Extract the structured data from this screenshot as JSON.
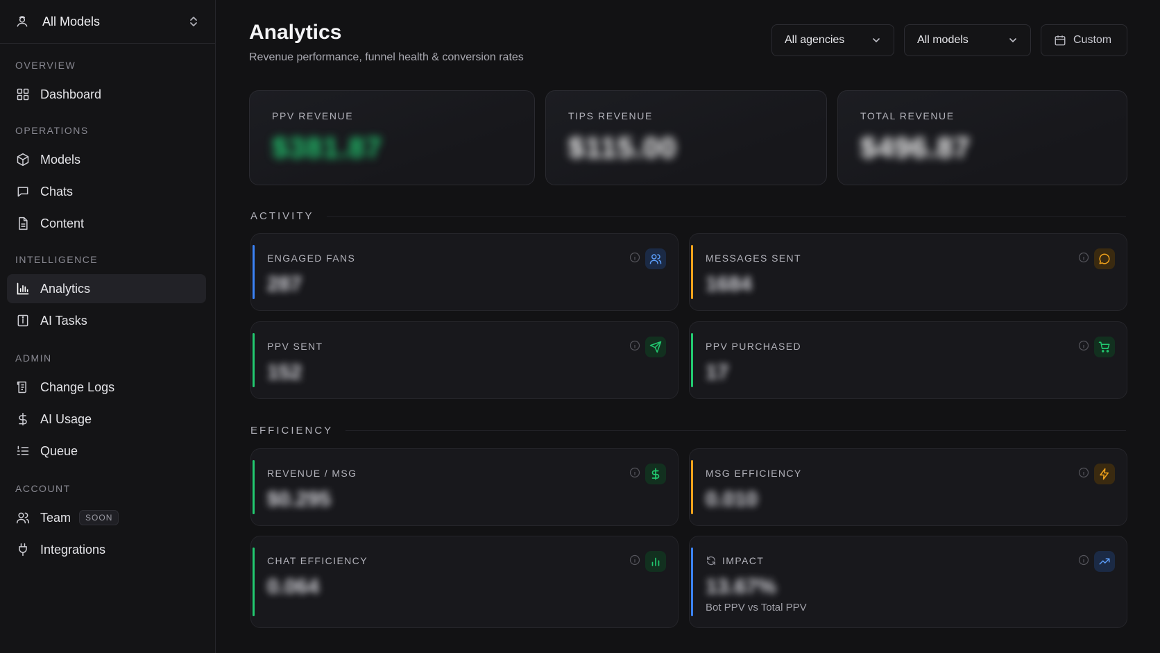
{
  "sidebar": {
    "model_switcher": {
      "label": "All Models"
    },
    "sections": {
      "overview": "OVERVIEW",
      "operations": "OPERATIONS",
      "intelligence": "INTELLIGENCE",
      "admin": "ADMIN",
      "account": "ACCOUNT"
    },
    "items": {
      "dashboard": "Dashboard",
      "models": "Models",
      "chats": "Chats",
      "content": "Content",
      "analytics": "Analytics",
      "ai_tasks": "AI Tasks",
      "change_logs": "Change Logs",
      "ai_usage": "AI Usage",
      "queue": "Queue",
      "team": "Team",
      "team_badge": "SOON",
      "integrations": "Integrations"
    }
  },
  "header": {
    "title": "Analytics",
    "subtitle": "Revenue performance, funnel health & conversion rates"
  },
  "filters": {
    "agencies": "All agencies",
    "models": "All models",
    "date": "Custom"
  },
  "revenue": {
    "ppv": {
      "label": "PPV REVENUE",
      "value": "$381.87"
    },
    "tips": {
      "label": "TIPS REVENUE",
      "value": "$115.00"
    },
    "total": {
      "label": "TOTAL REVENUE",
      "value": "$496.87"
    }
  },
  "activity": {
    "title": "ACTIVITY",
    "engaged_fans": {
      "label": "ENGAGED FANS",
      "value": "287"
    },
    "messages_sent": {
      "label": "MESSAGES SENT",
      "value": "1684"
    },
    "ppv_sent": {
      "label": "PPV SENT",
      "value": "152"
    },
    "ppv_purchased": {
      "label": "PPV PURCHASED",
      "value": "17"
    }
  },
  "efficiency": {
    "title": "EFFICIENCY",
    "revenue_per_msg": {
      "label": "REVENUE / MSG",
      "value": "$0.295"
    },
    "msg_efficiency": {
      "label": "MSG EFFICIENCY",
      "value": "0.010"
    },
    "chat_efficiency": {
      "label": "CHAT EFFICIENCY",
      "value": "0.064"
    },
    "impact": {
      "label": "IMPACT",
      "value": "13.67%",
      "sub": "Bot PPV vs Total PPV"
    }
  },
  "colors": {
    "blue": "#3b82f6",
    "amber": "#f0a21b",
    "green": "#22c970"
  }
}
